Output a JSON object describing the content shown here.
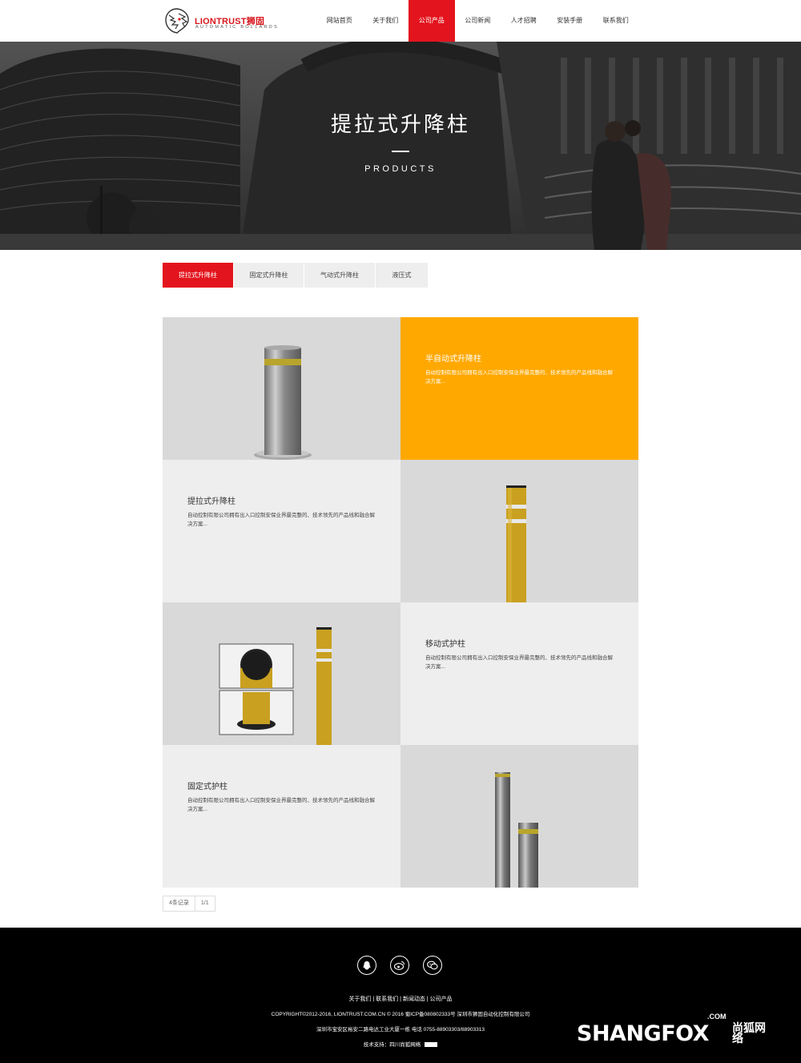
{
  "header": {
    "logo_name": "LIONTRUST狮固",
    "logo_sub": "AUTOMATIC BOLLARDS",
    "nav": [
      "网站首页",
      "关于我们",
      "公司产品",
      "公司新闻",
      "人才招聘",
      "安装手册",
      "联系我们"
    ],
    "active_nav": 2
  },
  "banner": {
    "title": "提拉式升降柱",
    "subtitle": "PRODUCTS"
  },
  "tabs": [
    "提拉式升降柱",
    "固定式升降柱",
    "气动式升降柱",
    "液压式"
  ],
  "products": [
    {
      "title": "半自动式升降柱",
      "desc": "自动控制有限公司拥有出入口控制安保业界最完整的、技术领先的产品线和融合解决方案..."
    },
    {
      "title": "提拉式升降柱",
      "desc": "自动控制有限公司拥有出入口控制安保业界最完整的、技术领先的产品线和融合解决方案..."
    },
    {
      "title": "移动式护柱",
      "desc": "自动控制有限公司拥有出入口控制安保业界最完整的、技术领先的产品线和融合解决方案..."
    },
    {
      "title": "固定式护柱",
      "desc": "自动控制有限公司拥有出入口控制安保业界最完整的、技术领先的产品线和融合解决方案..."
    }
  ],
  "pager": {
    "records": "4条记录",
    "pages": "1/1"
  },
  "footer": {
    "social_icons": [
      "qq-icon",
      "weibo-icon",
      "wechat-icon"
    ],
    "links": "关于我们 | 联系我们 | 新闻动态 | 公司产品",
    "copyright": "COPYRIGHT©2012-2016, LIONTRUST.COM.CN © 2016 蜀ICP备08080233​3号 深圳市狮固自动化控制有限公司",
    "address": "深圳市宝安区裕安二路电达工业大厦一栋 电话 0755-88903303/88903313",
    "support": "技术支持：四川尚狐网络"
  },
  "watermark": {
    "com": ".COM",
    "word": "SHANGFOX",
    "cn": "尚狐网络"
  },
  "colors": {
    "accent": "#e3141d",
    "orange": "#ffa800",
    "footer_bg": "#000000"
  }
}
